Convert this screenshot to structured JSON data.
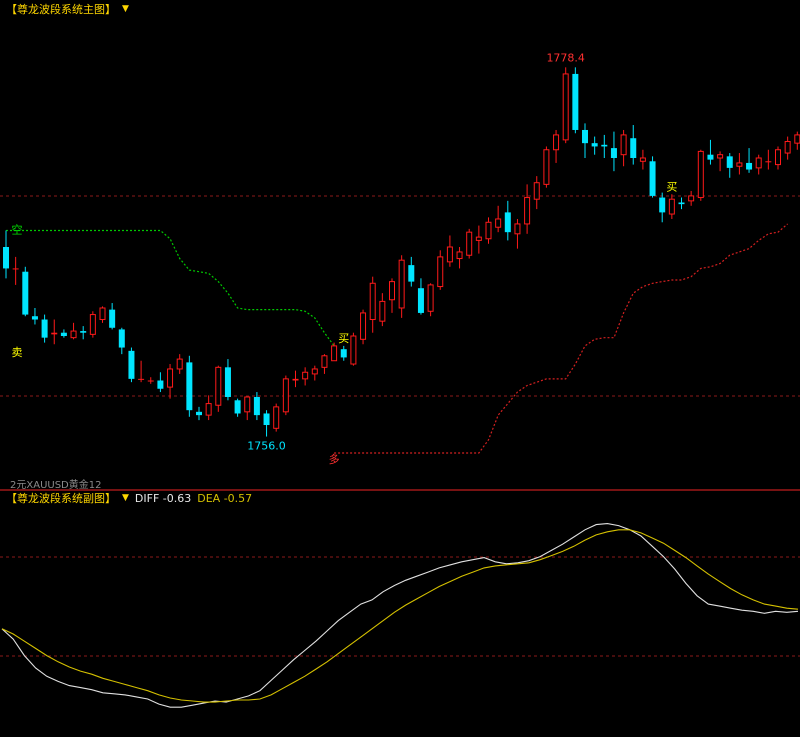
{
  "main_panel": {
    "title": "【尊龙波段系统主图】",
    "chevron_icon": "chevron-down-icon",
    "watermark": "XAUUSD黄金12",
    "watermark_prefix": "2元"
  },
  "sub_panel": {
    "title": "【尊龙波段系统副图】",
    "chevron_icon": "chevron-down-icon",
    "diff_text": "DIFF -0.63",
    "dea_text": "DEA -0.57"
  },
  "colors": {
    "background": "#000000",
    "up_candle": "#ff1a1a",
    "down_candle": "#00e5ff",
    "stop_line_green": "#00c800",
    "stop_line_red": "#d42020",
    "grid_red": "#8b1a1a",
    "diff_line": "#e0e0e0",
    "dea_line": "#d4c000",
    "label_yellow": "#ffff00",
    "label_high": "#ff3030",
    "label_low": "#00e5ff"
  },
  "chart_data": [
    {
      "type": "candlestick",
      "title": "【尊龙波段系统主图】",
      "ylim": [
        1753.0,
        1782.0
      ],
      "annotations": [
        {
          "text": "1778.4",
          "kind": "high",
          "index": 58
        },
        {
          "text": "1756.0",
          "kind": "low",
          "index": 27
        },
        {
          "text": "空",
          "kind": "short-stop-start",
          "index": 1
        },
        {
          "text": "卖",
          "kind": "sell-signal",
          "index": 1
        },
        {
          "text": "买",
          "kind": "buy-signal",
          "index": 35
        },
        {
          "text": "多",
          "kind": "long-stop-start",
          "index": 34
        },
        {
          "text": "买",
          "kind": "buy-signal",
          "index": 69
        }
      ],
      "candles": [
        [
          1767.5,
          1768.5,
          1765.6,
          1766.2
        ],
        [
          1766.2,
          1766.9,
          1765.2,
          1766.2
        ],
        [
          1766.0,
          1766.3,
          1763.3,
          1763.4
        ],
        [
          1763.3,
          1763.8,
          1762.8,
          1763.1
        ],
        [
          1763.1,
          1763.4,
          1761.7,
          1762.0
        ],
        [
          1762.2,
          1763.1,
          1761.6,
          1762.3
        ],
        [
          1762.3,
          1762.5,
          1762.0,
          1762.1
        ],
        [
          1762.0,
          1762.9,
          1761.9,
          1762.4
        ],
        [
          1762.4,
          1762.7,
          1761.9,
          1762.3
        ],
        [
          1762.2,
          1763.6,
          1762.0,
          1763.4
        ],
        [
          1763.1,
          1763.9,
          1762.9,
          1763.8
        ],
        [
          1763.7,
          1764.1,
          1762.5,
          1762.6
        ],
        [
          1762.5,
          1762.6,
          1761.0,
          1761.4
        ],
        [
          1761.2,
          1761.4,
          1759.3,
          1759.5
        ],
        [
          1759.5,
          1760.6,
          1759.3,
          1759.5
        ],
        [
          1759.4,
          1759.6,
          1759.2,
          1759.4
        ],
        [
          1759.4,
          1759.9,
          1758.7,
          1758.9
        ],
        [
          1759.0,
          1760.4,
          1758.3,
          1760.1
        ],
        [
          1760.1,
          1761.0,
          1759.8,
          1760.7
        ],
        [
          1760.5,
          1760.9,
          1757.2,
          1757.6
        ],
        [
          1757.5,
          1757.8,
          1757.0,
          1757.3
        ],
        [
          1757.3,
          1758.5,
          1757.0,
          1758.0
        ],
        [
          1757.9,
          1760.3,
          1757.5,
          1760.2
        ],
        [
          1760.2,
          1760.7,
          1758.2,
          1758.4
        ],
        [
          1758.2,
          1758.3,
          1757.2,
          1757.4
        ],
        [
          1757.5,
          1758.4,
          1757.0,
          1758.4
        ],
        [
          1758.4,
          1758.7,
          1757.0,
          1757.3
        ],
        [
          1757.4,
          1757.6,
          1756.0,
          1756.7
        ],
        [
          1756.5,
          1758.0,
          1756.3,
          1757.8
        ],
        [
          1757.5,
          1759.7,
          1757.3,
          1759.5
        ],
        [
          1759.4,
          1760.0,
          1759.0,
          1759.5
        ],
        [
          1759.5,
          1760.2,
          1759.1,
          1759.9
        ],
        [
          1759.8,
          1760.3,
          1759.4,
          1760.1
        ],
        [
          1760.2,
          1761.0,
          1759.8,
          1760.9
        ],
        [
          1760.6,
          1761.7,
          1760.6,
          1761.5
        ],
        [
          1761.3,
          1761.5,
          1760.6,
          1760.8
        ],
        [
          1760.4,
          1762.3,
          1760.3,
          1762.1
        ],
        [
          1761.9,
          1763.7,
          1761.6,
          1763.5
        ],
        [
          1763.1,
          1765.7,
          1762.3,
          1765.3
        ],
        [
          1763.0,
          1764.7,
          1762.7,
          1764.2
        ],
        [
          1764.3,
          1765.6,
          1763.5,
          1765.4
        ],
        [
          1763.8,
          1767.0,
          1763.2,
          1766.7
        ],
        [
          1766.4,
          1766.9,
          1765.1,
          1765.4
        ],
        [
          1765.0,
          1765.6,
          1763.4,
          1763.5
        ],
        [
          1763.6,
          1765.3,
          1763.3,
          1765.2
        ],
        [
          1765.1,
          1767.3,
          1764.9,
          1766.9
        ],
        [
          1766.6,
          1768.2,
          1766.3,
          1767.5
        ],
        [
          1766.8,
          1767.5,
          1766.2,
          1767.2
        ],
        [
          1767.0,
          1768.6,
          1766.8,
          1768.4
        ],
        [
          1767.9,
          1768.8,
          1767.1,
          1768.1
        ],
        [
          1768.0,
          1769.3,
          1767.7,
          1769.0
        ],
        [
          1768.7,
          1770.0,
          1768.4,
          1769.2
        ],
        [
          1769.6,
          1770.3,
          1767.9,
          1768.4
        ],
        [
          1768.3,
          1769.2,
          1767.4,
          1768.9
        ],
        [
          1768.9,
          1771.3,
          1768.3,
          1770.5
        ],
        [
          1770.4,
          1771.8,
          1769.8,
          1771.4
        ],
        [
          1771.3,
          1773.6,
          1771.1,
          1773.4
        ],
        [
          1773.4,
          1774.6,
          1772.6,
          1774.3
        ],
        [
          1774.0,
          1778.4,
          1773.8,
          1778.0
        ],
        [
          1778.0,
          1778.4,
          1774.4,
          1774.6
        ],
        [
          1774.6,
          1775.0,
          1772.9,
          1773.8
        ],
        [
          1773.8,
          1774.2,
          1773.1,
          1773.6
        ],
        [
          1773.7,
          1774.3,
          1772.9,
          1773.6
        ],
        [
          1773.5,
          1774.5,
          1772.1,
          1772.9
        ],
        [
          1773.1,
          1774.6,
          1772.4,
          1774.3
        ],
        [
          1774.1,
          1774.9,
          1772.5,
          1772.9
        ],
        [
          1772.7,
          1773.4,
          1772.2,
          1772.9
        ],
        [
          1772.7,
          1773.0,
          1770.5,
          1770.6
        ],
        [
          1770.5,
          1770.8,
          1769.0,
          1769.6
        ],
        [
          1769.5,
          1770.7,
          1769.2,
          1770.4
        ],
        [
          1770.2,
          1770.5,
          1769.8,
          1770.1
        ],
        [
          1770.3,
          1770.9,
          1770.0,
          1770.6
        ],
        [
          1770.5,
          1773.4,
          1770.3,
          1773.3
        ],
        [
          1773.1,
          1774.0,
          1772.5,
          1772.8
        ],
        [
          1772.9,
          1773.3,
          1772.1,
          1773.1
        ],
        [
          1773.0,
          1773.2,
          1771.7,
          1772.3
        ],
        [
          1772.4,
          1773.2,
          1771.9,
          1772.6
        ],
        [
          1772.6,
          1773.5,
          1772.0,
          1772.2
        ],
        [
          1772.3,
          1773.1,
          1771.9,
          1772.9
        ],
        [
          1772.7,
          1773.4,
          1772.2,
          1772.7
        ],
        [
          1772.5,
          1773.6,
          1772.2,
          1773.4
        ],
        [
          1773.2,
          1774.2,
          1772.8,
          1773.9
        ],
        [
          1773.8,
          1774.5,
          1773.4,
          1774.3
        ]
      ],
      "short_stop_line": {
        "x_start": 0,
        "x_end": 34,
        "values": [
          1768.5,
          1768.5,
          1768.5,
          1768.5,
          1768.5,
          1768.5,
          1768.5,
          1768.5,
          1768.5,
          1768.5,
          1768.5,
          1768.5,
          1768.5,
          1768.5,
          1768.5,
          1768.5,
          1768.5,
          1768.0,
          1766.8,
          1766.1,
          1766.0,
          1765.9,
          1765.4,
          1764.7,
          1763.8,
          1763.7,
          1763.7,
          1763.7,
          1763.7,
          1763.7,
          1763.7,
          1763.6,
          1763.2,
          1762.3,
          1761.5
        ]
      },
      "long_stop_line": {
        "x_start": 34,
        "x_end": 81,
        "values": [
          1755.0,
          1755.0,
          1755.0,
          1755.0,
          1755.0,
          1755.0,
          1755.0,
          1755.0,
          1755.0,
          1755.0,
          1755.0,
          1755.0,
          1755.0,
          1755.0,
          1755.0,
          1755.0,
          1755.8,
          1757.3,
          1758.0,
          1758.7,
          1759.1,
          1759.3,
          1759.5,
          1759.5,
          1759.5,
          1760.4,
          1761.5,
          1761.9,
          1762.0,
          1762.0,
          1763.5,
          1764.7,
          1765.1,
          1765.3,
          1765.4,
          1765.5,
          1765.5,
          1765.7,
          1766.2,
          1766.3,
          1766.5,
          1767.0,
          1767.2,
          1767.4,
          1767.9,
          1768.3,
          1768.4,
          1768.9
        ]
      }
    },
    {
      "type": "line",
      "title": "【尊龙波段系统副图】",
      "ylim": [
        -1.2,
        1.0
      ],
      "series": [
        {
          "name": "DIFF",
          "values": [
            -0.2,
            -0.3,
            -0.46,
            -0.58,
            -0.66,
            -0.71,
            -0.75,
            -0.77,
            -0.79,
            -0.82,
            -0.83,
            -0.84,
            -0.86,
            -0.88,
            -0.93,
            -0.96,
            -0.96,
            -0.94,
            -0.92,
            -0.9,
            -0.91,
            -0.88,
            -0.85,
            -0.8,
            -0.7,
            -0.6,
            -0.5,
            -0.41,
            -0.32,
            -0.22,
            -0.12,
            -0.04,
            0.04,
            0.08,
            0.16,
            0.22,
            0.27,
            0.31,
            0.35,
            0.39,
            0.42,
            0.45,
            0.47,
            0.49,
            0.45,
            0.43,
            0.44,
            0.46,
            0.5,
            0.56,
            0.62,
            0.69,
            0.76,
            0.81,
            0.82,
            0.8,
            0.76,
            0.7,
            0.6,
            0.5,
            0.38,
            0.24,
            0.12,
            0.04,
            0.02,
            0.0,
            -0.02,
            -0.03,
            -0.05,
            -0.03,
            -0.04,
            -0.03
          ]
        },
        {
          "name": "DEA",
          "values": [
            -0.2,
            -0.25,
            -0.32,
            -0.39,
            -0.46,
            -0.52,
            -0.57,
            -0.61,
            -0.64,
            -0.68,
            -0.71,
            -0.74,
            -0.77,
            -0.8,
            -0.84,
            -0.87,
            -0.89,
            -0.9,
            -0.91,
            -0.91,
            -0.9,
            -0.89,
            -0.89,
            -0.88,
            -0.84,
            -0.78,
            -0.72,
            -0.66,
            -0.59,
            -0.52,
            -0.44,
            -0.36,
            -0.28,
            -0.2,
            -0.12,
            -0.04,
            0.03,
            0.09,
            0.15,
            0.21,
            0.26,
            0.31,
            0.35,
            0.39,
            0.41,
            0.42,
            0.43,
            0.44,
            0.47,
            0.51,
            0.55,
            0.6,
            0.66,
            0.71,
            0.74,
            0.76,
            0.76,
            0.73,
            0.68,
            0.63,
            0.56,
            0.49,
            0.41,
            0.33,
            0.26,
            0.19,
            0.13,
            0.08,
            0.04,
            0.02,
            0.0,
            -0.01
          ]
        }
      ]
    }
  ]
}
